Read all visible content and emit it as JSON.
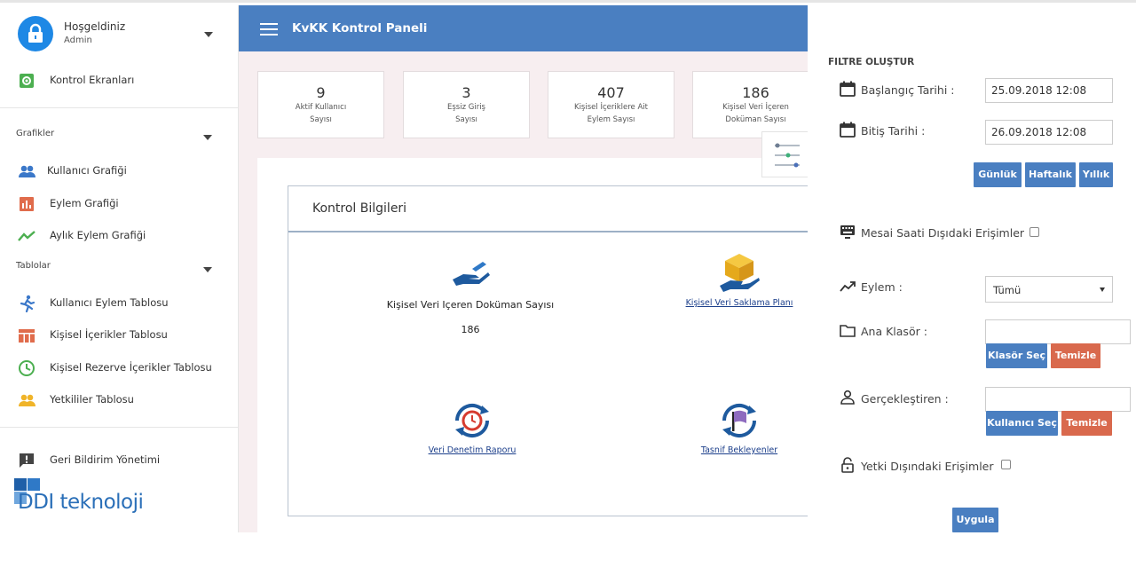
{
  "user": {
    "greeting": "Hoşgeldiniz",
    "role": "Admin"
  },
  "sidebar": {
    "dashboard": "Kontrol Ekranları",
    "charts_title": "Grafikler",
    "charts": [
      "Kullanıcı Grafiği",
      "Eylem Grafiği",
      "Aylık Eylem Grafiği"
    ],
    "tables_title": "Tablolar",
    "tables": [
      "Kullanıcı Eylem Tablosu",
      "Kişisel İçerikler Tablosu",
      "Kişisel Rezerve İçerikler Tablosu",
      "Yetkililer Tablosu"
    ],
    "feedback": "Geri Bildirim Yönetimi",
    "brand_text": "DDI teknoloji"
  },
  "topbar": {
    "title": "KvKK Kontrol Paneli"
  },
  "stats": [
    {
      "value": "9",
      "caption": "Aktif Kullanıcı Sayısı"
    },
    {
      "value": "3",
      "caption": "Eşsiz Giriş Sayısı"
    },
    {
      "value": "407",
      "caption": "Kişisel İçeriklere Ait Eylem Sayısı"
    },
    {
      "value": "186",
      "caption": "Kişisel Veri İçeren Doküman Sayısı"
    }
  ],
  "panel": {
    "title": "Kontrol Bilgileri",
    "doc_count_title": "Kişisel Veri Içeren Doküman Sayısı",
    "doc_count_value": "186",
    "retention_link": "Kişisel Veri Saklama Planı",
    "audit_link": "Veri Denetim Raporu",
    "classification_link": "Tasnif Bekleyenler"
  },
  "filter": {
    "heading": "FILTRE OLUŞTUR",
    "start_label": "Başlangıç Tarihi :",
    "start_value": "25.09.2018 12:08",
    "end_label": "Bitiş Tarihi :",
    "end_value": "26.09.2018 12:08",
    "daily": "Günlük",
    "weekly": "Haftalık",
    "yearly": "Yıllık",
    "off_hours_label": "Mesai Saati Dışıdaki Erişimler",
    "action_label": "Eylem :",
    "action_selected": "Tümü",
    "folder_label": "Ana Klasör :",
    "folder_value": "",
    "folder_select": "Klasör Seç",
    "folder_clear": "Temizle",
    "performer_label": "Gerçekleştiren :",
    "performer_value": "",
    "user_select": "Kullanıcı Seç",
    "user_clear": "Temizle",
    "unauthorized_label": "Yetki Dışındaki Erişimler",
    "apply": "Uygula"
  },
  "colors": {
    "primary": "#4a7fc1",
    "danger": "#d9694d",
    "avatar": "#1e88e5"
  }
}
